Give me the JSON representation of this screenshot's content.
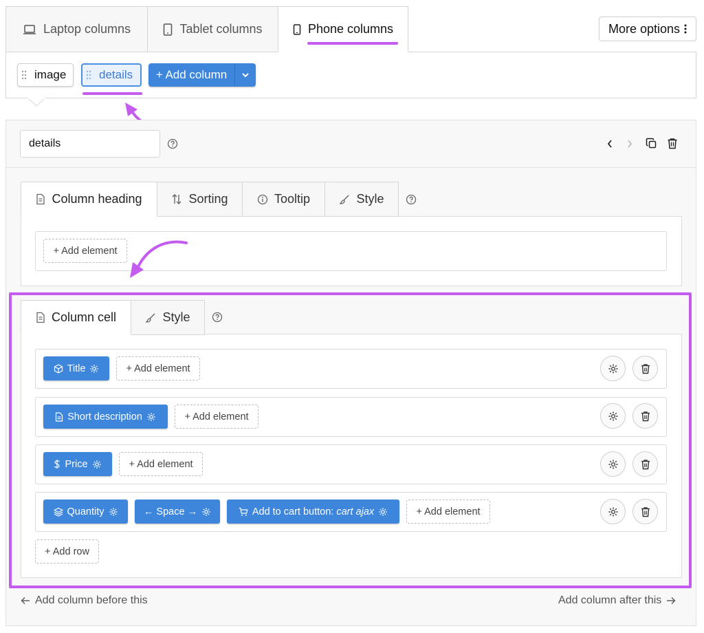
{
  "device_tabs": [
    {
      "label": "Laptop columns",
      "icon": "laptop-icon"
    },
    {
      "label": "Tablet columns",
      "icon": "tablet-icon"
    },
    {
      "label": "Phone columns",
      "icon": "phone-icon",
      "active": true
    }
  ],
  "more_options_label": "More options",
  "columns": [
    {
      "label": "image"
    },
    {
      "label": "details",
      "selected": true
    }
  ],
  "add_column_label": "+ Add column",
  "editor": {
    "column_name_value": "details",
    "heading_tabs": [
      {
        "label": "Column heading",
        "icon": "document-icon",
        "active": true
      },
      {
        "label": "Sorting",
        "icon": "sort-icon"
      },
      {
        "label": "Tooltip",
        "icon": "info-icon"
      },
      {
        "label": "Style",
        "icon": "brush-icon"
      }
    ],
    "heading_add_element": "+ Add element",
    "cell_tabs": [
      {
        "label": "Column cell",
        "icon": "document-icon",
        "active": true
      },
      {
        "label": "Style",
        "icon": "brush-icon"
      }
    ],
    "rows": [
      {
        "elements": [
          {
            "label": "Title",
            "icon": "cube-icon"
          }
        ],
        "add_label": "+ Add element"
      },
      {
        "elements": [
          {
            "label": "Short description",
            "icon": "document-icon"
          }
        ],
        "add_label": "+ Add element"
      },
      {
        "elements": [
          {
            "label": "Price",
            "icon": "dollar-icon"
          }
        ],
        "add_label": "+ Add element"
      },
      {
        "elements": [
          {
            "label": "Quantity",
            "icon": "layers-icon"
          },
          {
            "label": "← Space →",
            "icon": ""
          },
          {
            "label": "Add to cart button: ",
            "extra": "cart ajax",
            "icon": "cart-icon"
          }
        ],
        "add_label": "+ Add element"
      }
    ],
    "add_row_label": "+ Add row"
  },
  "footer": {
    "add_before": "Add column before this",
    "add_after": "Add column after this"
  },
  "colors": {
    "accent_blue": "#3d86dc",
    "highlight_purple": "#c45cf0"
  }
}
